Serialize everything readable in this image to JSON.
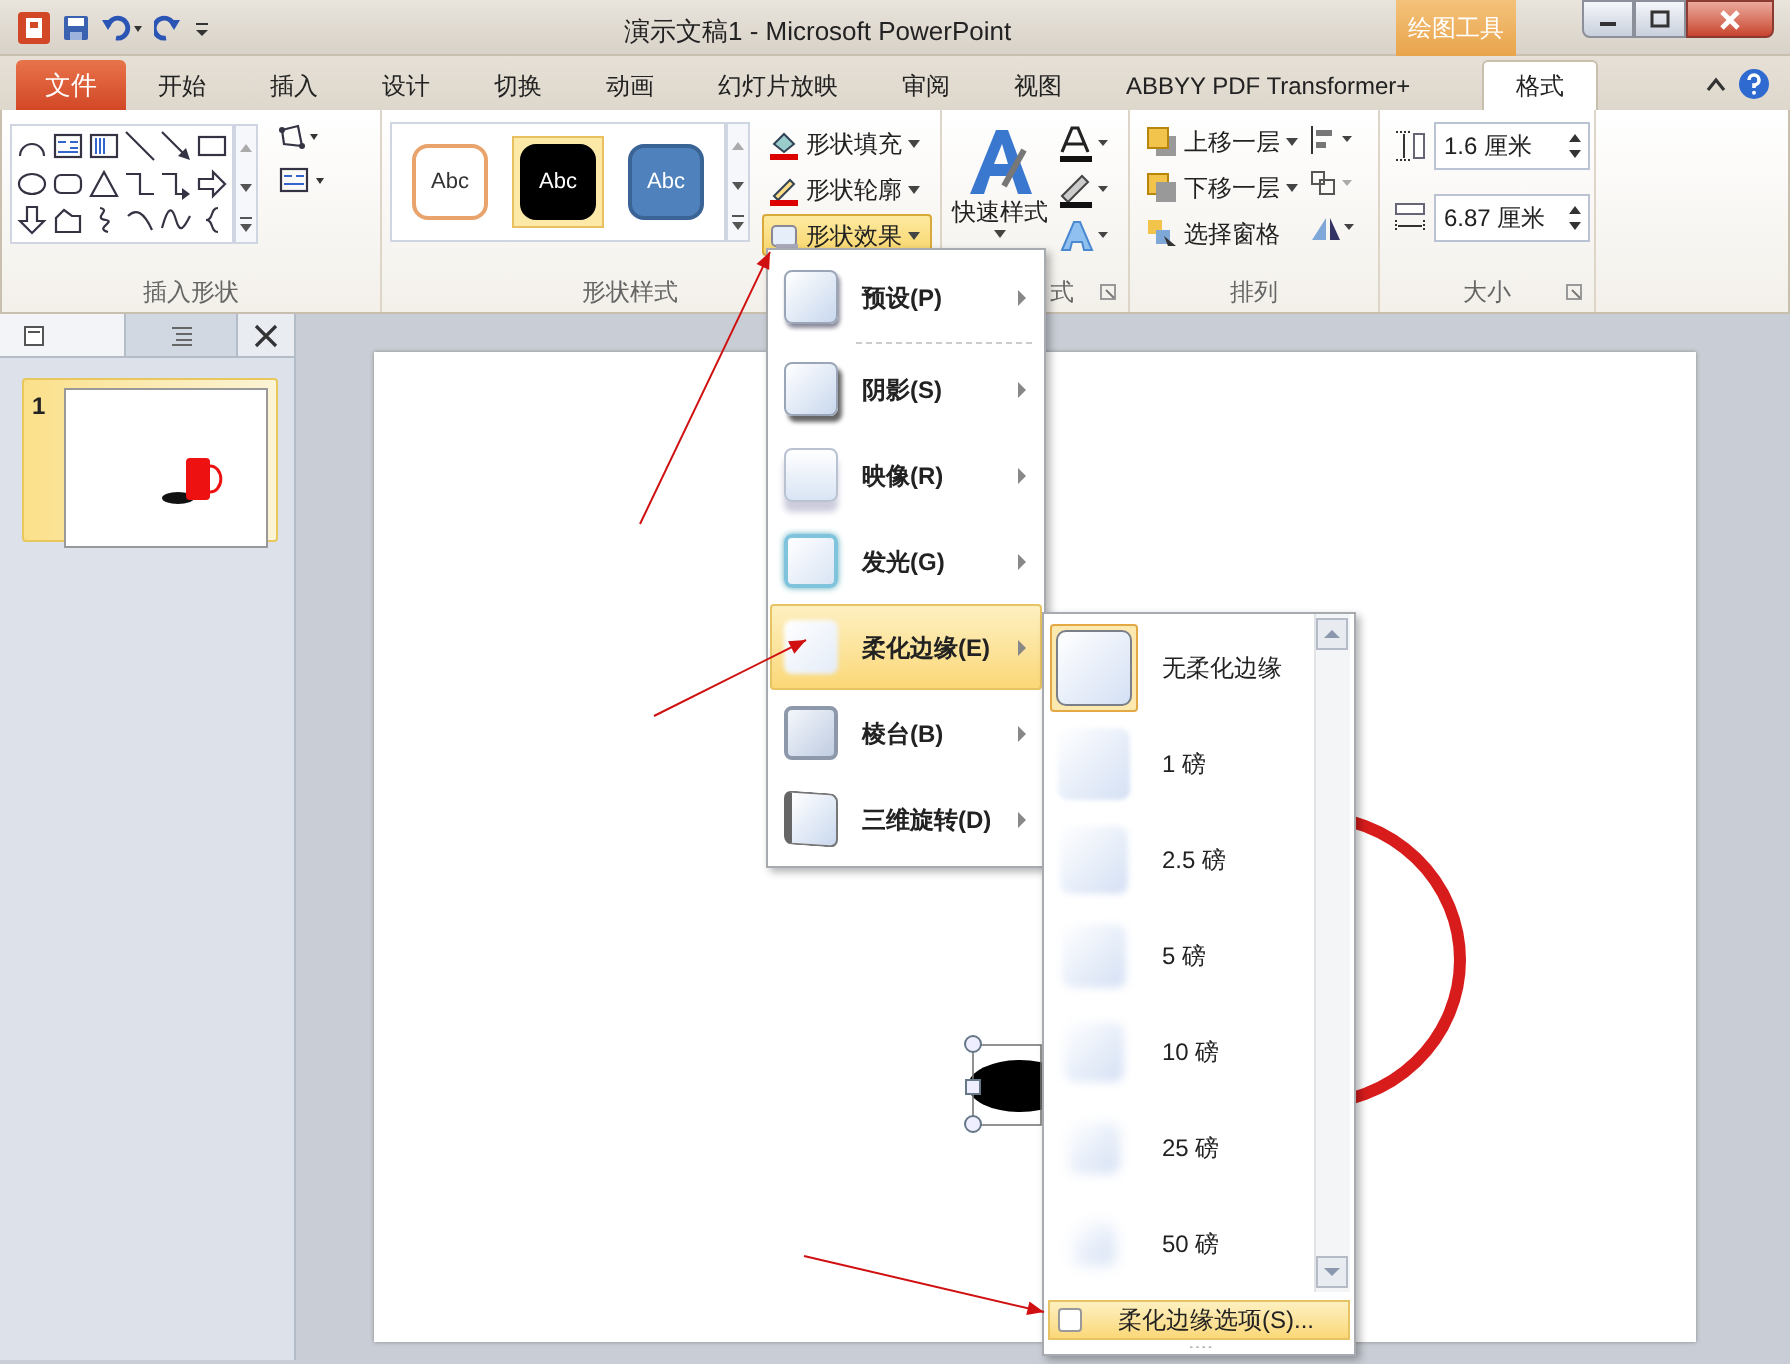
{
  "title_bar": {
    "title": "演示文稿1 - Microsoft PowerPoint",
    "context_tab": "绘图工具"
  },
  "tabs": [
    {
      "label": "文件",
      "kind": "file",
      "selected": false
    },
    {
      "label": "开始",
      "kind": "tab",
      "selected": false
    },
    {
      "label": "插入",
      "kind": "tab",
      "selected": false
    },
    {
      "label": "设计",
      "kind": "tab",
      "selected": false
    },
    {
      "label": "切换",
      "kind": "tab",
      "selected": false
    },
    {
      "label": "动画",
      "kind": "tab",
      "selected": false
    },
    {
      "label": "幻灯片放映",
      "kind": "tab",
      "selected": false
    },
    {
      "label": "审阅",
      "kind": "tab",
      "selected": false
    },
    {
      "label": "视图",
      "kind": "tab",
      "selected": false
    },
    {
      "label": "ABBYY PDF Transformer+",
      "kind": "tab",
      "selected": false
    },
    {
      "label": "格式",
      "kind": "tab",
      "selected": true
    }
  ],
  "ribbon": {
    "style_gallery": [
      {
        "label": "Abc",
        "kind": "outline",
        "selected": false
      },
      {
        "label": "Abc",
        "kind": "black",
        "selected": true
      },
      {
        "label": "Abc",
        "kind": "blue",
        "selected": false
      }
    ],
    "shape_commands": [
      {
        "label": "形状填充",
        "kind": "fill",
        "selected": false
      },
      {
        "label": "形状轮廓",
        "kind": "outline",
        "selected": false
      },
      {
        "label": "形状效果",
        "kind": "effects",
        "selected": true
      }
    ],
    "quick_style": "快速样式",
    "arrange_commands": [
      {
        "label": "上移一层",
        "kind": "forward"
      },
      {
        "label": "下移一层",
        "kind": "backward"
      },
      {
        "label": "选择窗格",
        "kind": "pane"
      }
    ],
    "size_fields": [
      {
        "value": "1.6 厘米",
        "kind": "height"
      },
      {
        "value": "6.87 厘米",
        "kind": "width"
      }
    ],
    "group_labels": [
      "插入形状",
      "形状样式",
      "式",
      "排列",
      "大小"
    ]
  },
  "slides": [
    {
      "number": "1",
      "selected": true
    }
  ],
  "effects_menu": [
    {
      "label": "预设(P)",
      "kind": "preset",
      "selected": false
    },
    {
      "label": "阴影(S)",
      "kind": "shadow",
      "selected": false
    },
    {
      "label": "映像(R)",
      "kind": "reflection",
      "selected": false
    },
    {
      "label": "发光(G)",
      "kind": "glow",
      "selected": false
    },
    {
      "label": "柔化边缘(E)",
      "kind": "soft",
      "selected": true
    },
    {
      "label": "棱台(B)",
      "kind": "bevel",
      "selected": false
    },
    {
      "label": "三维旋转(D)",
      "kind": "rotation",
      "selected": false
    }
  ],
  "soft_edges_menu": {
    "options": [
      {
        "label": "无柔化边缘",
        "selected": true
      },
      {
        "label": "1 磅",
        "selected": false
      },
      {
        "label": "2.5 磅",
        "selected": false
      },
      {
        "label": "5 磅",
        "selected": false
      },
      {
        "label": "10 磅",
        "selected": false
      },
      {
        "label": "25 磅",
        "selected": false
      },
      {
        "label": "50 磅",
        "selected": false
      }
    ],
    "footer": {
      "label": "柔化边缘选项(S)...",
      "selected": true
    }
  }
}
